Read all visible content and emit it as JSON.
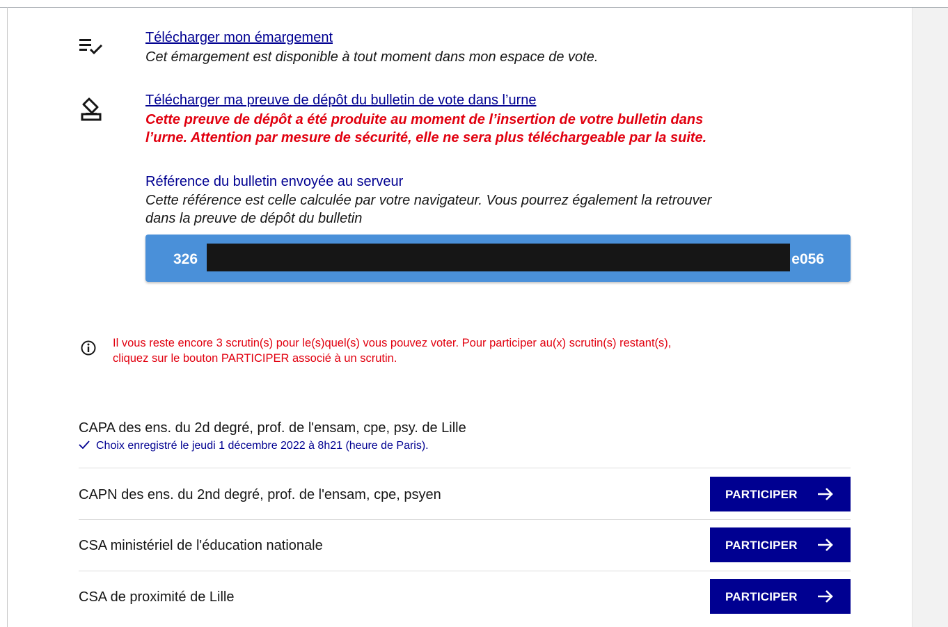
{
  "documents": {
    "emargement": {
      "icon": "list-check-icon",
      "link": "Télécharger mon émargement",
      "description": "Cet émargement est disponible à tout moment dans mon espace de vote."
    },
    "proof": {
      "icon": "ballot-box-icon",
      "link": "Télécharger ma preuve de dépôt du bulletin de vote dans l’urne",
      "warning_line1": "Cette preuve de dépôt a été produite au moment de l’insertion de votre bulletin dans",
      "warning_line2": "l’urne. Attention par mesure de sécurité, elle ne sera plus téléchargeable par la suite."
    },
    "reference": {
      "title": "Référence du bulletin envoyée au serveur",
      "description_line1": "Cette référence est celle calculée par votre navigateur. Vous pourrez également la retrouver",
      "description_line2": "dans la preuve de dépôt du bulletin",
      "hash_start": "326",
      "hash_end": "e056"
    }
  },
  "info": {
    "icon": "info-icon",
    "line1": "Il vous reste encore 3 scrutin(s) pour le(s)quel(s) vous pouvez voter. Pour participer au(x) scrutin(s) restant(s),",
    "line2": "cliquez sur le bouton PARTICIPER associé à un scrutin."
  },
  "elections": [
    {
      "name": "CAPA des ens. du 2d degré, prof. de l'ensam, cpe, psy. de Lille",
      "status": "Choix enregistré le jeudi 1 décembre 2022 à 8h21 (heure de Paris)."
    },
    {
      "name": "CAPN des ens. du 2nd degré, prof. de l'ensam, cpe, psyen",
      "button": "PARTICIPER"
    },
    {
      "name": "CSA ministériel de l'éducation nationale",
      "button": "PARTICIPER"
    },
    {
      "name": "CSA de proximité de Lille",
      "button": "PARTICIPER"
    }
  ],
  "colors": {
    "primary": "#000091",
    "error": "#e1000f",
    "hash_background": "#4a90d9",
    "text": "#161616"
  }
}
